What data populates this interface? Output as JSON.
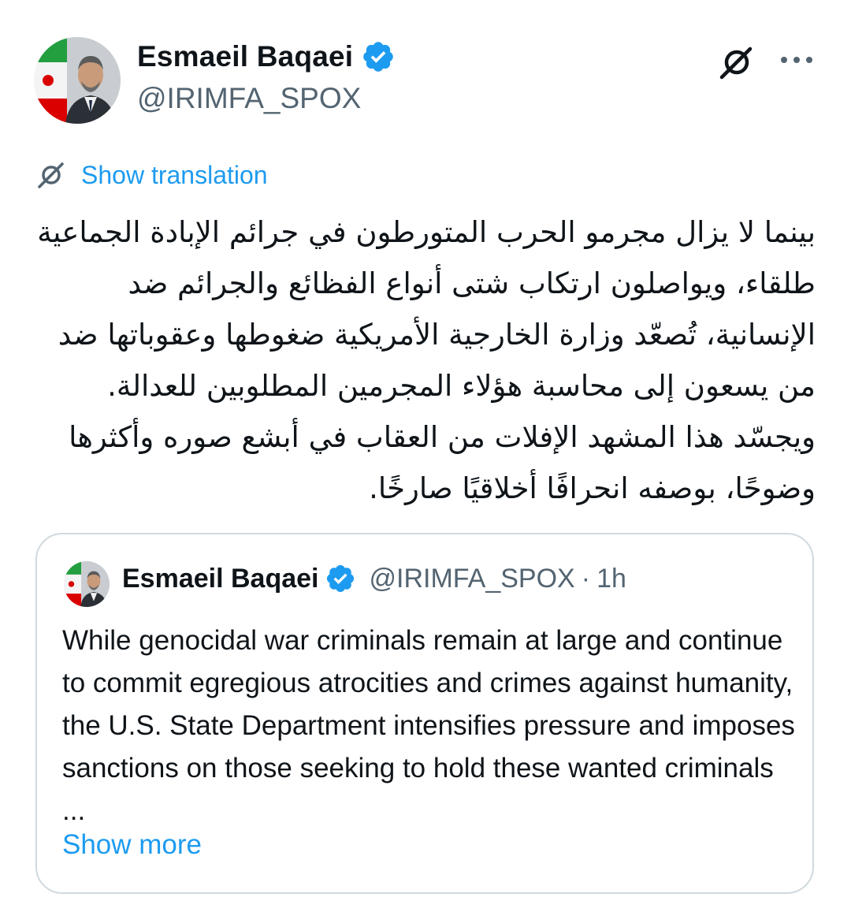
{
  "tweet": {
    "author_name": "Esmaeil Baqaei",
    "author_handle": "@IRIMFA_SPOX",
    "verified": true,
    "translate_label": "Show translation",
    "text": "بينما لا يزال مجرمو الحرب المتورطون في جرائم الإبادة الجماعية طلقاء، ويواصلون ارتكاب شتى أنواع الفظائع والجرائم ضد الإنسانية، تُصعّد وزارة الخارجية الأمريكية ضغوطها وعقوباتها ضد من يسعون إلى محاسبة هؤلاء المجرمين المطلوبين للعدالة. ويجسّد هذا المشهد الإفلات من العقاب في أبشع صوره وأكثرها وضوحًا، بوصفه انحرافًا أخلاقيًا صارخًا."
  },
  "quoted_tweet": {
    "author_name": "Esmaeil Baqaei",
    "author_handle": "@IRIMFA_SPOX",
    "separator": "·",
    "time": "1h",
    "text": "While genocidal war criminals remain at large and continue to commit egregious atrocities and crimes against humanity, the U.S. State Department intensifies pressure and imposes sanctions on those seeking to hold these wanted criminals ...",
    "show_more_label": "Show more"
  },
  "icons": {
    "verified": "verified-badge-icon",
    "grok": "grok-icon",
    "more": "more-horizontal-icon",
    "translate": "translate-icon"
  },
  "colors": {
    "accent": "#1d9bf0",
    "secondary_text": "#536471",
    "border": "#cfd9de",
    "flag_green": "#239f40",
    "flag_red": "#da0000"
  }
}
